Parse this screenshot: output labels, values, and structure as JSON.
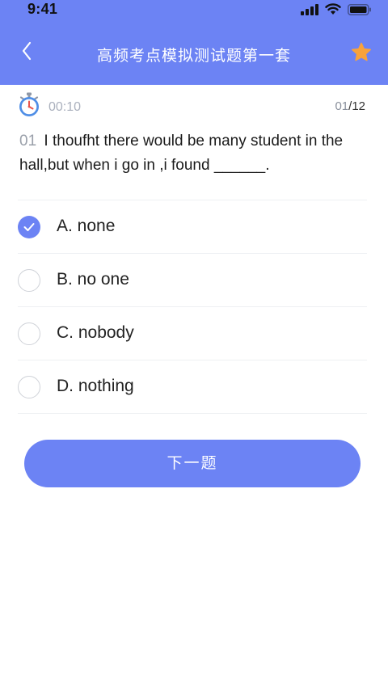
{
  "status_bar": {
    "time": "9:41",
    "icons": [
      "signal-icon",
      "wifi-icon",
      "battery-icon"
    ]
  },
  "header": {
    "title": "高频考点模拟测试题第一套",
    "back_icon": "chevron-left-icon",
    "favorite_icon": "star-icon",
    "background_color": "#6c83f4",
    "star_color": "#f8a23b"
  },
  "meta": {
    "timer_icon": "stopwatch-icon",
    "elapsed": "00:10",
    "progress_current": "01",
    "progress_separator": "/",
    "progress_total": "12"
  },
  "question": {
    "number": "01",
    "text": "I thoufht there would be many student in the hall,but when i go in ,i found ______."
  },
  "options": [
    {
      "label": "A. none",
      "selected": true
    },
    {
      "label": "B. no one",
      "selected": false
    },
    {
      "label": "C. nobody",
      "selected": false
    },
    {
      "label": "D. nothing",
      "selected": false
    }
  ],
  "next_button": {
    "label": "下一题"
  }
}
